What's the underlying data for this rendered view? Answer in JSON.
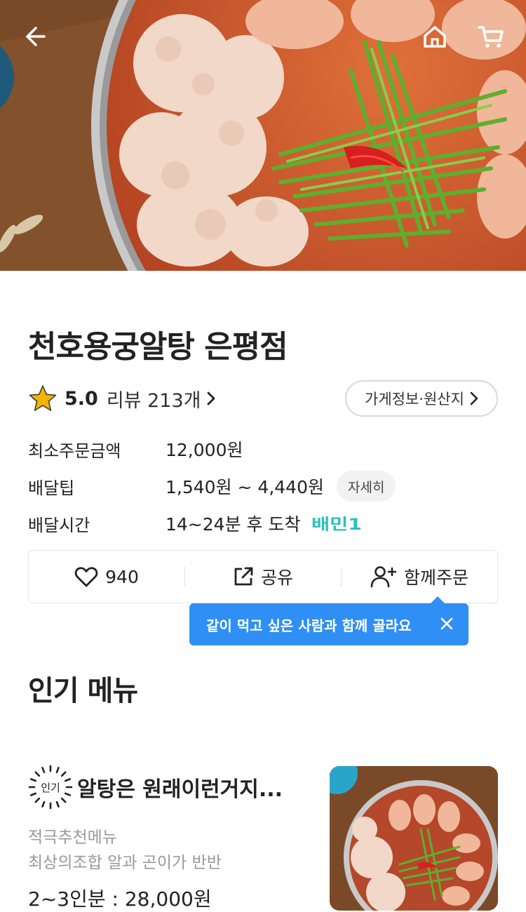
{
  "header": {
    "back_icon": "back-arrow-icon",
    "home_icon": "home-icon",
    "cart_icon": "cart-icon"
  },
  "store": {
    "name": "천호용궁알탕 은평점",
    "rating": "5.0",
    "review_label": "리뷰 213개",
    "info_button": "가게정보·원산지"
  },
  "info": {
    "min_order_label": "최소주문금액",
    "min_order_value": "12,000원",
    "delivery_tip_label": "배달팁",
    "delivery_tip_value": "1,540원 ~ 4,440원",
    "detail_chip": "자세히",
    "delivery_time_label": "배달시간",
    "delivery_time_value": "14~24분 후 도착",
    "badge_text": "배민1"
  },
  "actions": {
    "like_count": "940",
    "share_label": "공유",
    "group_order_label": "함께주문"
  },
  "tooltip": {
    "text": "같이 먹고 싶은 사람과 함께 골라요"
  },
  "popular": {
    "section_title": "인기 메뉴",
    "items": [
      {
        "badge": "인기",
        "name": "알탕은 원래이런거지...",
        "desc1": "적극추천메뉴",
        "desc2": "최상의조합 알과 곤이가 반반",
        "price": "2~3인분 : 28,000원"
      }
    ]
  },
  "colors": {
    "accent_blue": "#2f8ff5",
    "baemin_teal": "#2ac1bc",
    "star": "#f5b400"
  }
}
